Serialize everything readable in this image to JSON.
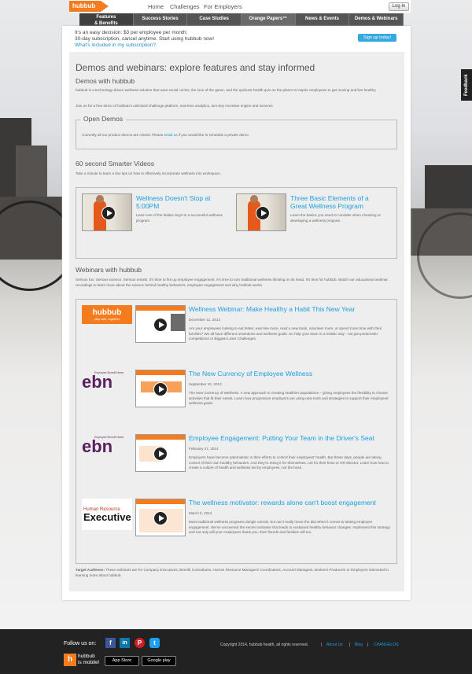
{
  "top_nav": {
    "logo": "hubbub",
    "links": [
      "Home",
      "Challenges",
      "For Employers"
    ],
    "login": "Log In"
  },
  "tabs": [
    {
      "l1": "Features",
      "l2": "& Benefits"
    },
    {
      "l1": "Success Stories",
      "l2": ""
    },
    {
      "l1": "Case Studies",
      "l2": ""
    },
    {
      "l1": "Orange Papers™",
      "l2": ""
    },
    {
      "l1": "News & Events",
      "l2": ""
    },
    {
      "l1": "Demos & Webinars",
      "l2": ""
    }
  ],
  "promo": {
    "line1": "It's an easy decision: $3 per employee per month;",
    "line2": "30-day subscription, cancel anytime. Start using hubbub now!",
    "link": "What's included in my subscription?",
    "button": "Sign up today!"
  },
  "page_title": "Demos and webinars: explore features and stay informed",
  "demos": {
    "heading": "Demos with hubbub",
    "p1": "hubbub is a technology-driven wellness solution that uses social circles, the love of the game, and the quickest health quiz on the planet to inspire employees to get moving and live healthy.",
    "p2": "Join us for a free demo of hubbub's unlimited challenge platform, real-time analytics, turn-key incentive engine and services."
  },
  "open_demos": {
    "legend": "Open Demos",
    "text_a": "Currently all our product demos are closed. Please ",
    "email": "email us",
    "text_b": " if you would like to schedule a private demo."
  },
  "videos": {
    "heading": "60 second Smarter Videos",
    "intro": "Take a minute to learn a few tips on how to effectively incorporate wellness into workspace.",
    "items": [
      {
        "title": "Wellness Doesn't Stop at 5:00PM",
        "desc": "Learn one of the hidden keys to a successful wellness program."
      },
      {
        "title": "Three Basic Elements of a Great Wellness Program",
        "desc": "Learn the basics you need to consider when choosing or developing a wellness program."
      }
    ]
  },
  "webinars": {
    "heading": "Webinars with hubbub",
    "intro": "Serious fun. Serious science. Serious results. It's time to fire up employee engagement. It's time to turn traditional wellness thinking on its head. It's time for hubbub. Watch our educational webinar recordings to learn more about the science behind healthy behaviors, employee engagement and why hubbub works.",
    "items": [
      {
        "logo": "hubbub",
        "logo_sub": "play well, together",
        "title": "Wellness Webinar: Make Healthy a Habit This New Year",
        "date": "December 11, 2014",
        "desc": "Are your employees looking to eat better, exercise more, read a new book, volunteer more, or spend more time with their families? We all have different resolutions and wellness goals. So help your team in a holistic way - not just pedometer competitions or Biggest Loser Challenges."
      },
      {
        "logo": "ebn",
        "logo_sub": "Employee Benefit News",
        "title": "The New Currency of Employee Wellness",
        "date": "September 10, 2013",
        "desc": "The New Currency of Wellness. A new approach to creating healthier populations – giving employees the flexibility to choose activities that fit their needs. Learn how progressive employers are using new tools and strategies to support their employees' wellness goals."
      },
      {
        "logo": "ebn",
        "logo_sub": "Employee Benefit News",
        "title": "Employee Engagement: Putting Your Team in the Driver's Seat",
        "date": "February 27, 2014",
        "desc": "Employers have become paternalistic in their efforts to control their employees' health. But these days, people are taking control of their own healthy behaviors. And they're doing it for themselves, not for their boss or HR director. Learn how how to create a culture of health and wellness led by employees, not the boss."
      },
      {
        "logo": "Executive",
        "logo_sub": "Human Resource",
        "title": "The wellness motivator: rewards alone can't boost engagement",
        "date": "March 6, 2014",
        "desc": "Most traditional wellness programs dangle carrots, but can't really move the dial when it comes to lasting employee engagement. We've uncovered the secret motivator that leads to sustained healthy behavior changes. Implement this strategy and not only will your employees thank you, their friends and families will too."
      }
    ]
  },
  "target_audience": {
    "label": "Target Audience:",
    "text": " These webinars are for Company Executives, Benefit Consultants, Human Resource Managers/ Coordinators, Account Managers, Brokers/ Producers or Employers interested in learning more about hubbub."
  },
  "feedback": "Feedback",
  "footer": {
    "follow": "Follow us on:",
    "social": [
      "f",
      "in",
      "P",
      "t"
    ],
    "mobile_logo": "h",
    "mobile_l1": "hubbub",
    "mobile_l2": "is mobile!",
    "app_store": "App Store",
    "google_play": "Google play",
    "copyright": "Copyright 2014, hubbub health, all rights reserved.",
    "links": [
      "About Us",
      "Blog",
      "CHANGELOG"
    ]
  },
  "colors": {
    "accent": "#1aa1e0",
    "brand_orange": "#f47c1f",
    "footer": "#222222"
  }
}
